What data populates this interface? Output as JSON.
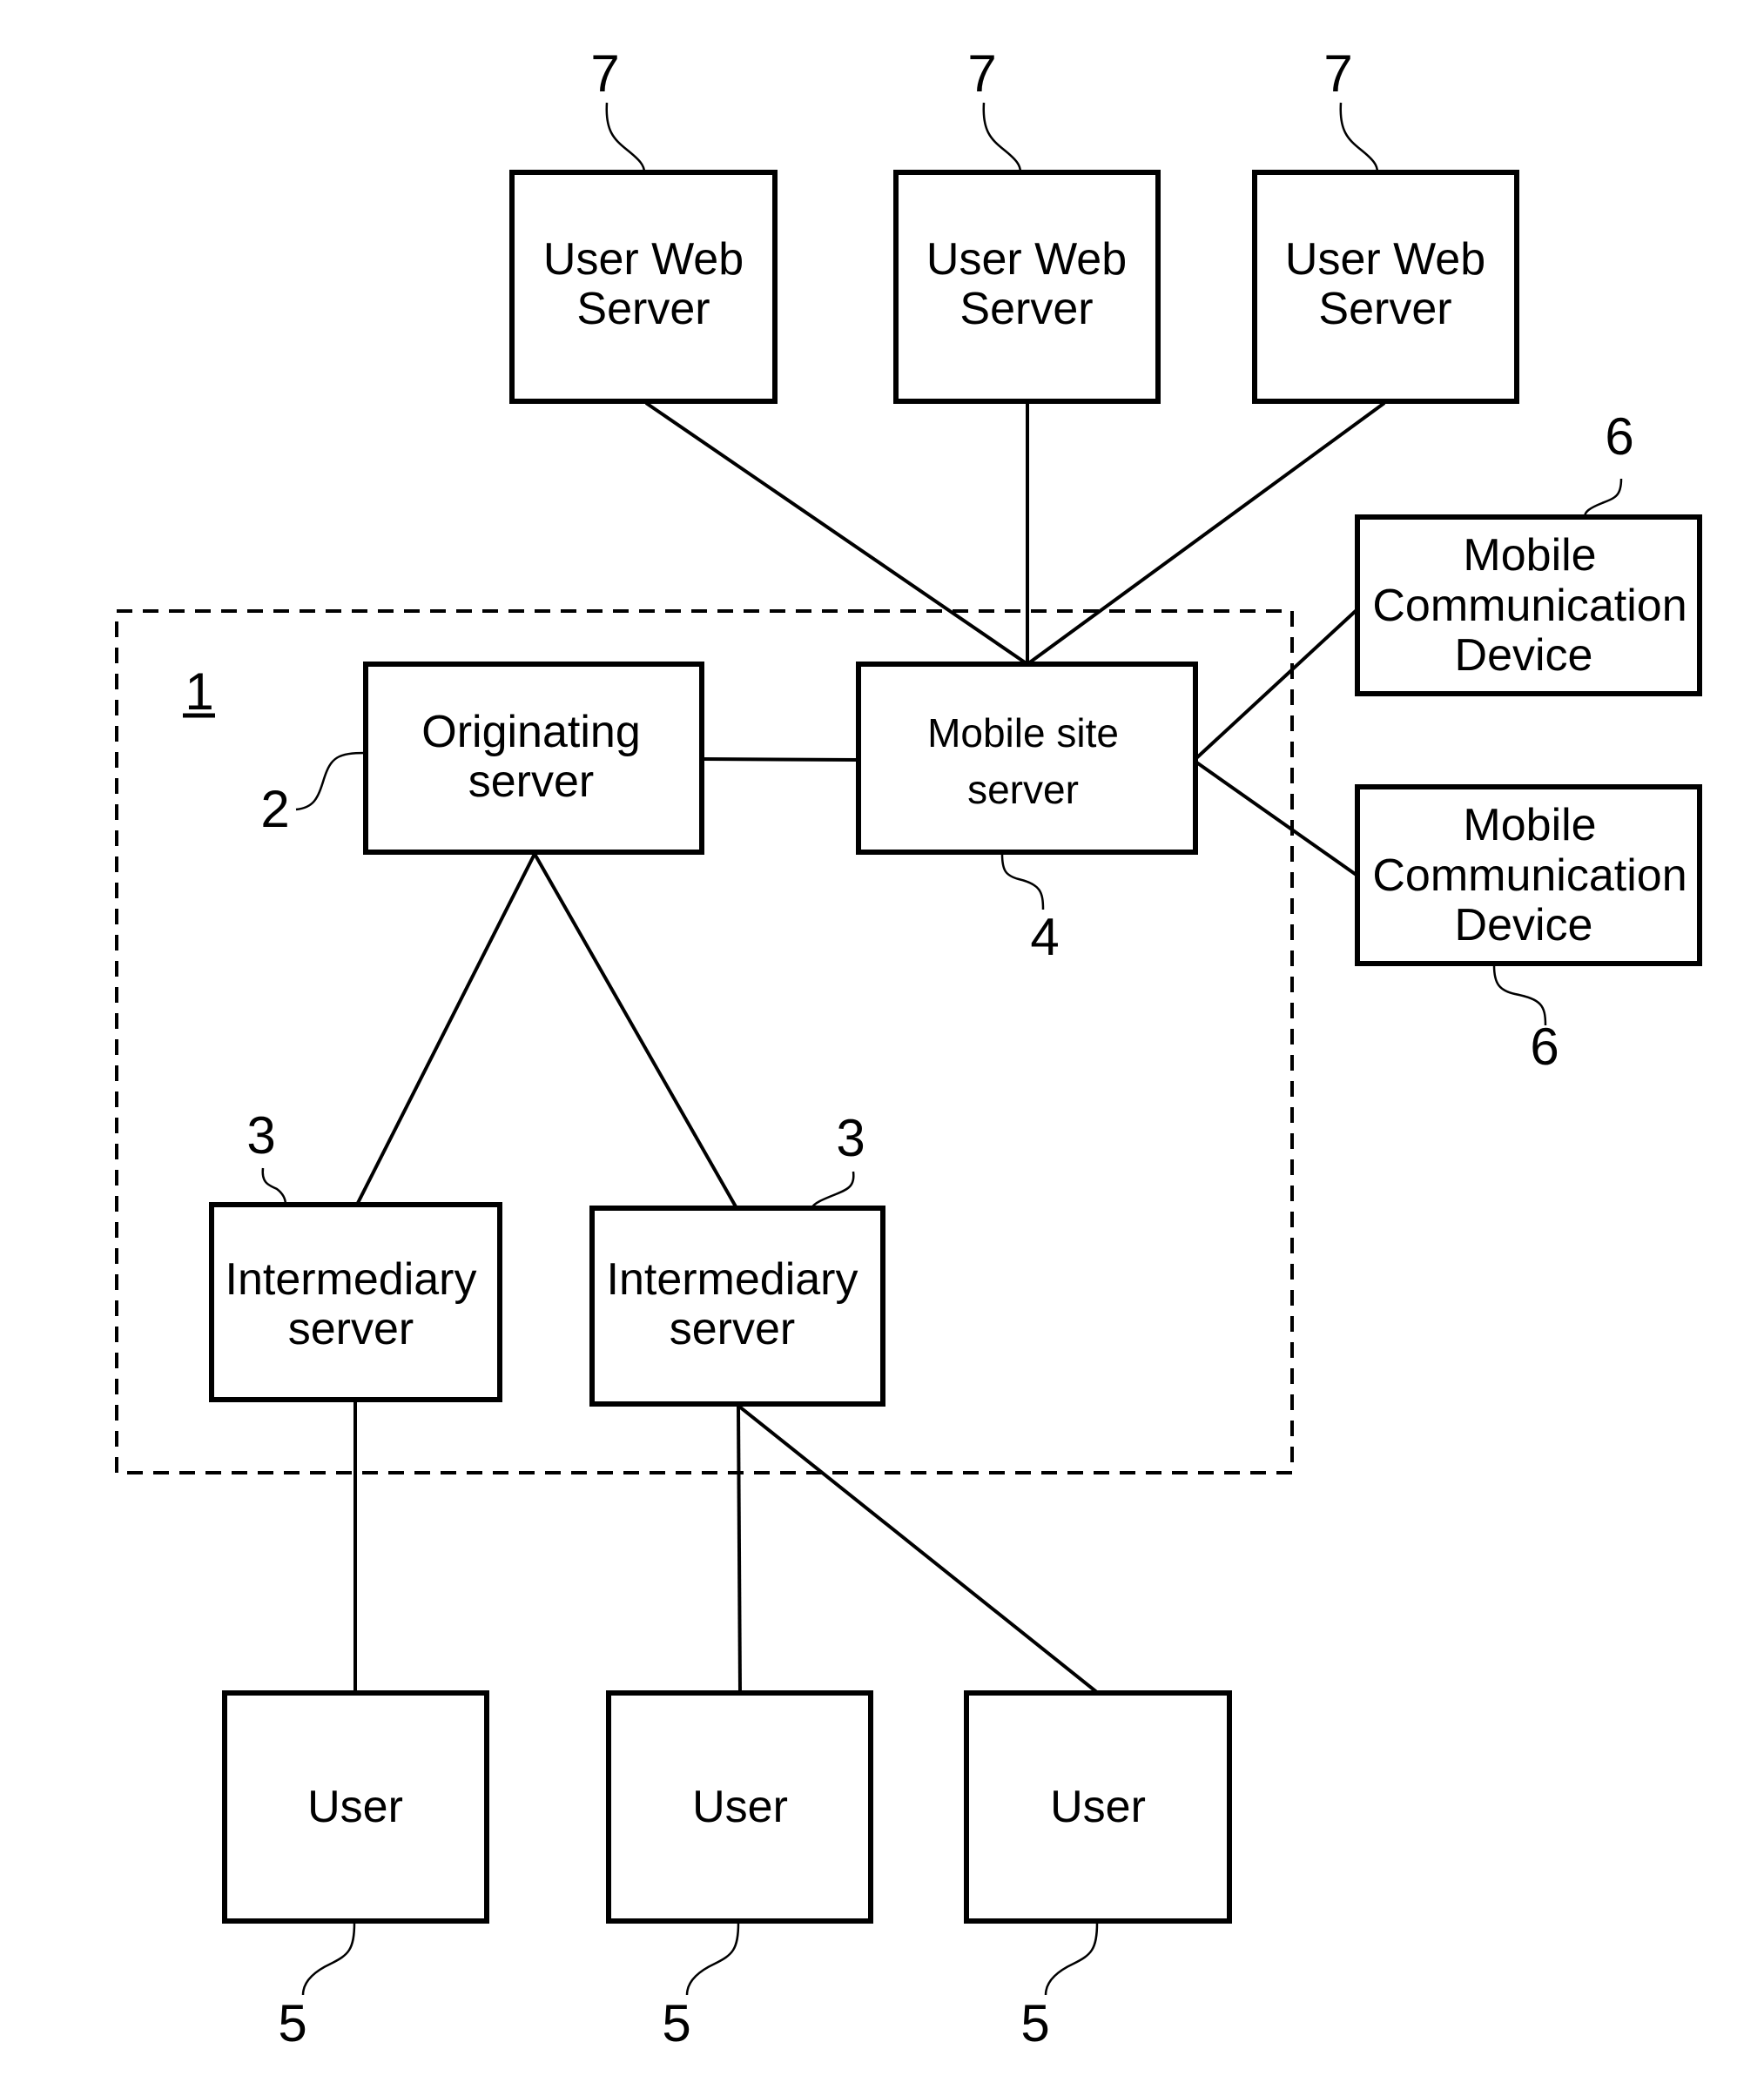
{
  "diagram": {
    "system_ref": "1",
    "nodes": {
      "user_web_server_1": {
        "label_lines": [
          "User Web",
          "Server"
        ],
        "ref": "7"
      },
      "user_web_server_2": {
        "label_lines": [
          "User Web",
          "Server"
        ],
        "ref": "7"
      },
      "user_web_server_3": {
        "label_lines": [
          "User Web",
          "Server"
        ],
        "ref": "7"
      },
      "mobile_device_1": {
        "label_lines": [
          "Mobile",
          "Communication",
          "Device"
        ],
        "ref": "6"
      },
      "mobile_device_2": {
        "label_lines": [
          "Mobile",
          "Communication",
          "Device"
        ],
        "ref": "6"
      },
      "originating_server": {
        "label_lines": [
          "Originating",
          "server"
        ],
        "ref": "2"
      },
      "mobile_site_server": {
        "label_lines": [
          "Mobile site",
          "server"
        ],
        "ref": "4"
      },
      "intermediary_server_1": {
        "label_lines": [
          "Intermediary",
          "server"
        ],
        "ref": "3"
      },
      "intermediary_server_2": {
        "label_lines": [
          "Intermediary",
          "server"
        ],
        "ref": "3"
      },
      "user_1": {
        "label_lines": [
          "User"
        ],
        "ref": "5"
      },
      "user_2": {
        "label_lines": [
          "User"
        ],
        "ref": "5"
      },
      "user_3": {
        "label_lines": [
          "User"
        ],
        "ref": "5"
      }
    },
    "edges": [
      [
        "user_web_server_1",
        "mobile_site_server"
      ],
      [
        "user_web_server_2",
        "mobile_site_server"
      ],
      [
        "user_web_server_3",
        "mobile_site_server"
      ],
      [
        "mobile_site_server",
        "mobile_device_1"
      ],
      [
        "mobile_site_server",
        "mobile_device_2"
      ],
      [
        "originating_server",
        "mobile_site_server"
      ],
      [
        "originating_server",
        "intermediary_server_1"
      ],
      [
        "originating_server",
        "intermediary_server_2"
      ],
      [
        "intermediary_server_1",
        "user_1"
      ],
      [
        "intermediary_server_2",
        "user_2"
      ],
      [
        "intermediary_server_2",
        "user_3"
      ]
    ]
  }
}
